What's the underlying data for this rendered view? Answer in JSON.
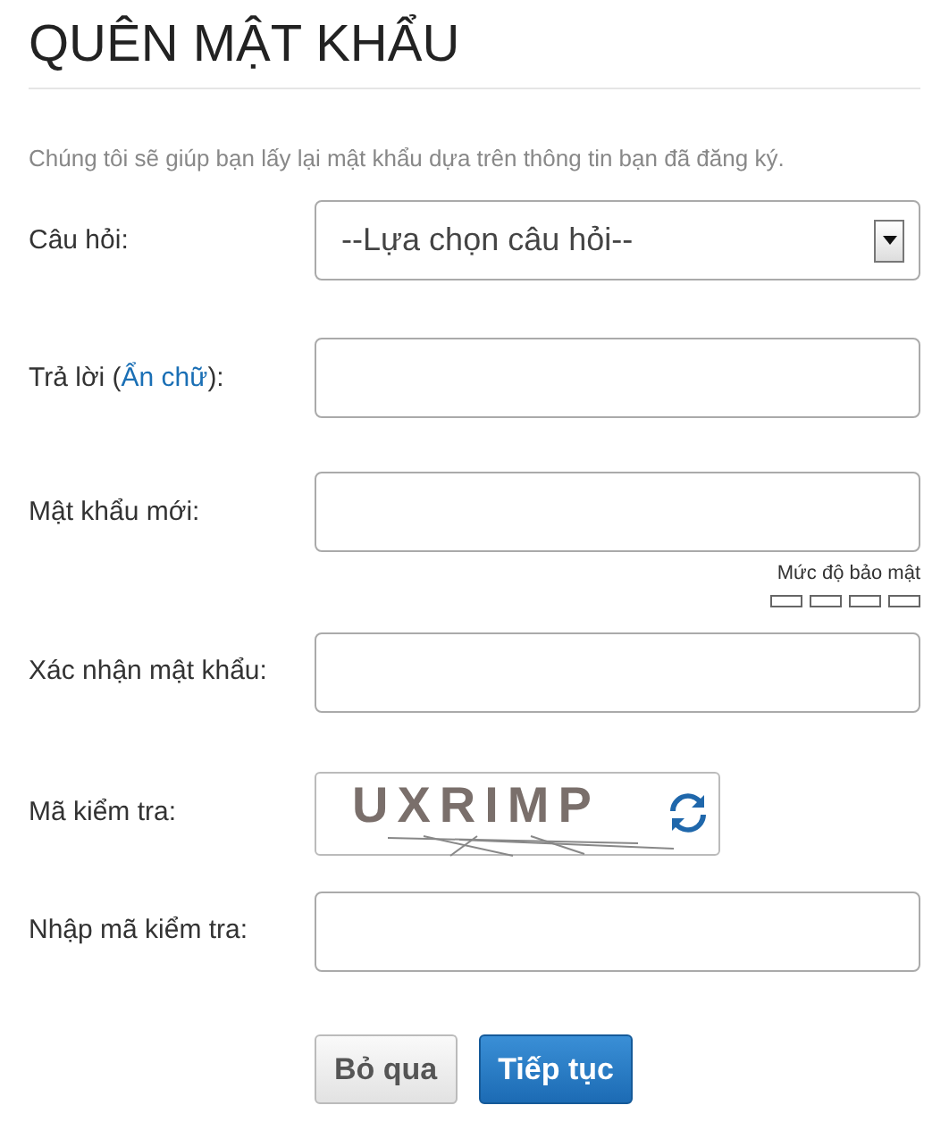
{
  "title": "QUÊN MẬT KHẨU",
  "description": "Chúng tôi sẽ giúp bạn lấy lại mật khẩu dựa trên thông tin bạn đã đăng ký.",
  "fields": [
    {
      "kind": "select",
      "label": "Câu hỏi:",
      "value": "--Lựa chọn câu hỏi--"
    },
    {
      "kind": "text",
      "label": "Trả lời (",
      "link": "Ẩn chữ",
      "label_end": "):"
    },
    {
      "kind": "password",
      "label": "Mật khẩu mới:",
      "strength": {
        "label": "Mức độ bảo mật"
      }
    },
    {
      "kind": "password",
      "label": "Xác nhận mật khẩu:"
    },
    {
      "kind": "captcha",
      "label": "Mã kiểm tra:",
      "captcha": "UXRIMP"
    },
    {
      "kind": "text",
      "label": "Nhập mã kiểm tra:"
    }
  ],
  "buttons": [
    {
      "label": "Bỏ qua",
      "primary": false
    },
    {
      "label": "Tiếp tục",
      "primary": true
    }
  ]
}
